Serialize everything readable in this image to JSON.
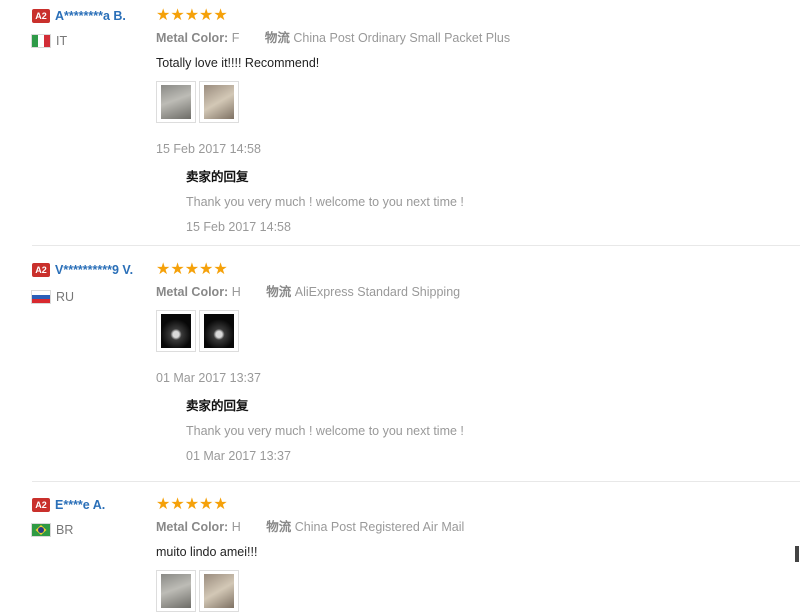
{
  "reviews": [
    {
      "badge": "A2",
      "username": "A********a B.",
      "country_code": "IT",
      "stars": "★★★★★",
      "rating": 5,
      "metal_color_label": "Metal Color:",
      "metal_color_value": "F",
      "shipping_label": "物流",
      "shipping_value": "China Post Ordinary Small Packet Plus",
      "text": "Totally love it!!!! Recommend!",
      "date": "15 Feb 2017 14:58",
      "reply_title": "卖家的回复",
      "reply_text": "Thank you very much ! welcome to you next time !",
      "reply_date": "15 Feb 2017 14:58"
    },
    {
      "badge": "A2",
      "username": "V**********9 V.",
      "country_code": "RU",
      "stars": "★★★★★",
      "rating": 5,
      "metal_color_label": "Metal Color:",
      "metal_color_value": "H",
      "shipping_label": "物流",
      "shipping_value": "AliExpress Standard Shipping",
      "date": "01 Mar 2017 13:37",
      "reply_title": "卖家的回复",
      "reply_text": "Thank you very much ! welcome to you next time !",
      "reply_date": "01 Mar 2017 13:37"
    },
    {
      "badge": "A2",
      "username": "E****e A.",
      "country_code": "BR",
      "stars": "★★★★★",
      "rating": 5,
      "metal_color_label": "Metal Color:",
      "metal_color_value": "H",
      "shipping_label": "物流",
      "shipping_value": "China Post Registered Air Mail",
      "text": "muito lindo amei!!!"
    }
  ],
  "colors": {
    "star": "#f5a10a",
    "username": "#2a6fb8",
    "badge": "#c9302c"
  },
  "icons": [
    "star-icon",
    "flag-italy-icon",
    "flag-russia-icon",
    "flag-brazil-icon",
    "review-photo-thumbnail"
  ]
}
